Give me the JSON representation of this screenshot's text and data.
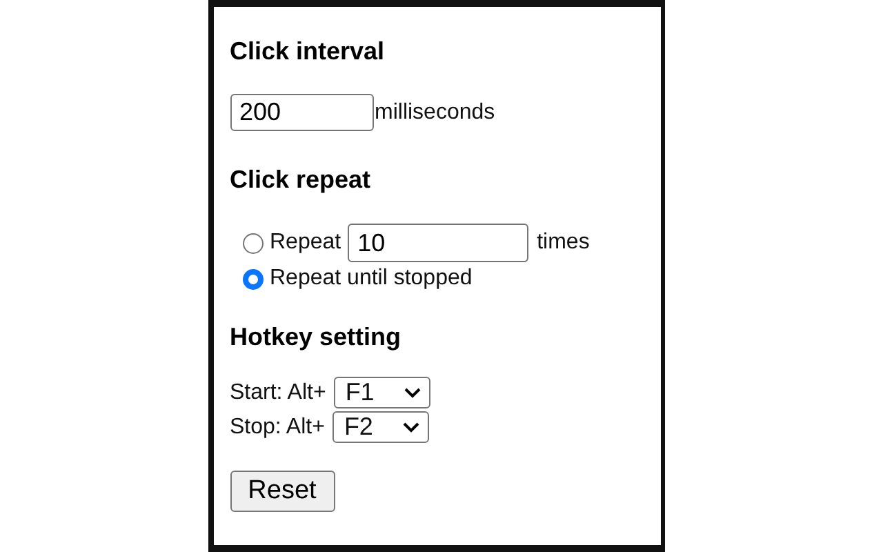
{
  "interval": {
    "heading": "Click interval",
    "value": "200",
    "unit": "milliseconds"
  },
  "repeat": {
    "heading": "Click repeat",
    "options": [
      {
        "kind": "count",
        "label": "Repeat",
        "value": "10",
        "unit": "times",
        "selected": false
      },
      {
        "kind": "plain",
        "label": "Repeat until stopped",
        "selected": true
      }
    ]
  },
  "hotkeys": {
    "heading": "Hotkey setting",
    "rows": [
      {
        "label": "Start: Alt+",
        "key": "F1"
      },
      {
        "label": "Stop: Alt+",
        "key": "F2"
      }
    ]
  },
  "reset_button": "Reset"
}
